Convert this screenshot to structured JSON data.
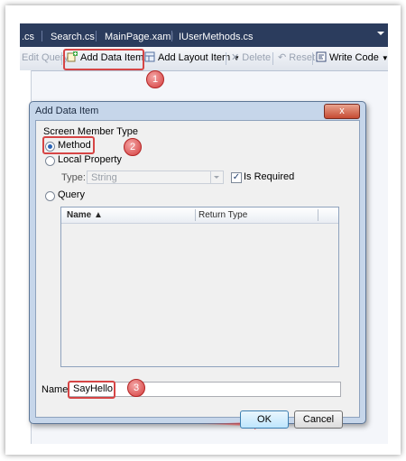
{
  "tabs": {
    "items": [
      ".cs",
      "Search.cs",
      "MainPage.xaml",
      "IUserMethods.cs"
    ]
  },
  "toolbar": {
    "edit_query": "Edit Query",
    "add_data_item": "Add Data Item...",
    "add_layout_item": "Add Layout Item",
    "delete": "Delete",
    "reset": "Reset",
    "write_code": "Write Code"
  },
  "dialog": {
    "title": "Add Data Item",
    "close": "x",
    "screen_member_type_label": "Screen Member Type",
    "options": {
      "method": "Method",
      "local_property": "Local Property",
      "query": "Query"
    },
    "type_label": "Type:",
    "type_value": "String",
    "is_required_label": "Is Required",
    "grid": {
      "columns": [
        "Name ▲",
        "Return Type"
      ]
    },
    "name_label": "Name:",
    "name_value": "SayHello",
    "ok": "OK",
    "cancel": "Cancel"
  },
  "callouts": [
    "1",
    "2",
    "3"
  ],
  "colors": {
    "tab_bar": "#2b3c5d",
    "highlight": "#d64545",
    "dialog_frame": "#c6d6ea",
    "arrow": "#e03a3a"
  }
}
